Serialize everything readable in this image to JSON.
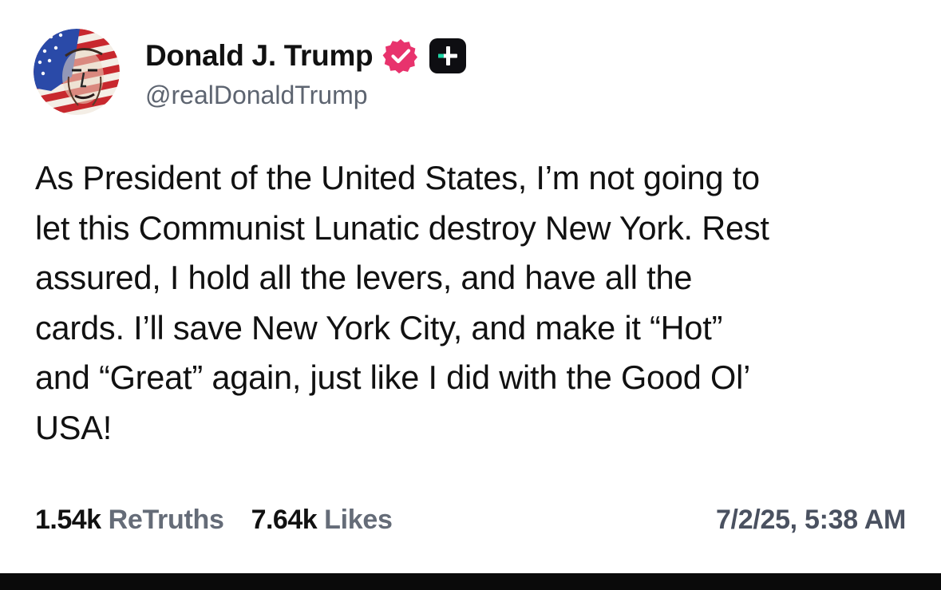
{
  "post": {
    "author": {
      "display_name": "Donald J. Trump",
      "handle": "@realDonaldTrump",
      "avatar_icon": "flag-portrait-avatar",
      "verified_icon": "verified-badge-icon",
      "verified_color": "#e8336d",
      "plus_icon": "truth-plus-icon",
      "plus_accent": "#1dd6a6"
    },
    "text": "As President of the United States, I’m not going to\nlet this Communist Lunatic destroy New York. Rest\nassured, I hold all the levers, and have all the\ncards. I’ll save New York City, and make it “Hot”\nand “Great” again, just like I did with the Good Ol’\nUSA!",
    "stats": {
      "retruths_count": "1.54k",
      "retruths_label": "ReTruths",
      "likes_count": "7.64k",
      "likes_label": "Likes"
    },
    "timestamp": "7/2/25, 5:38 AM"
  }
}
